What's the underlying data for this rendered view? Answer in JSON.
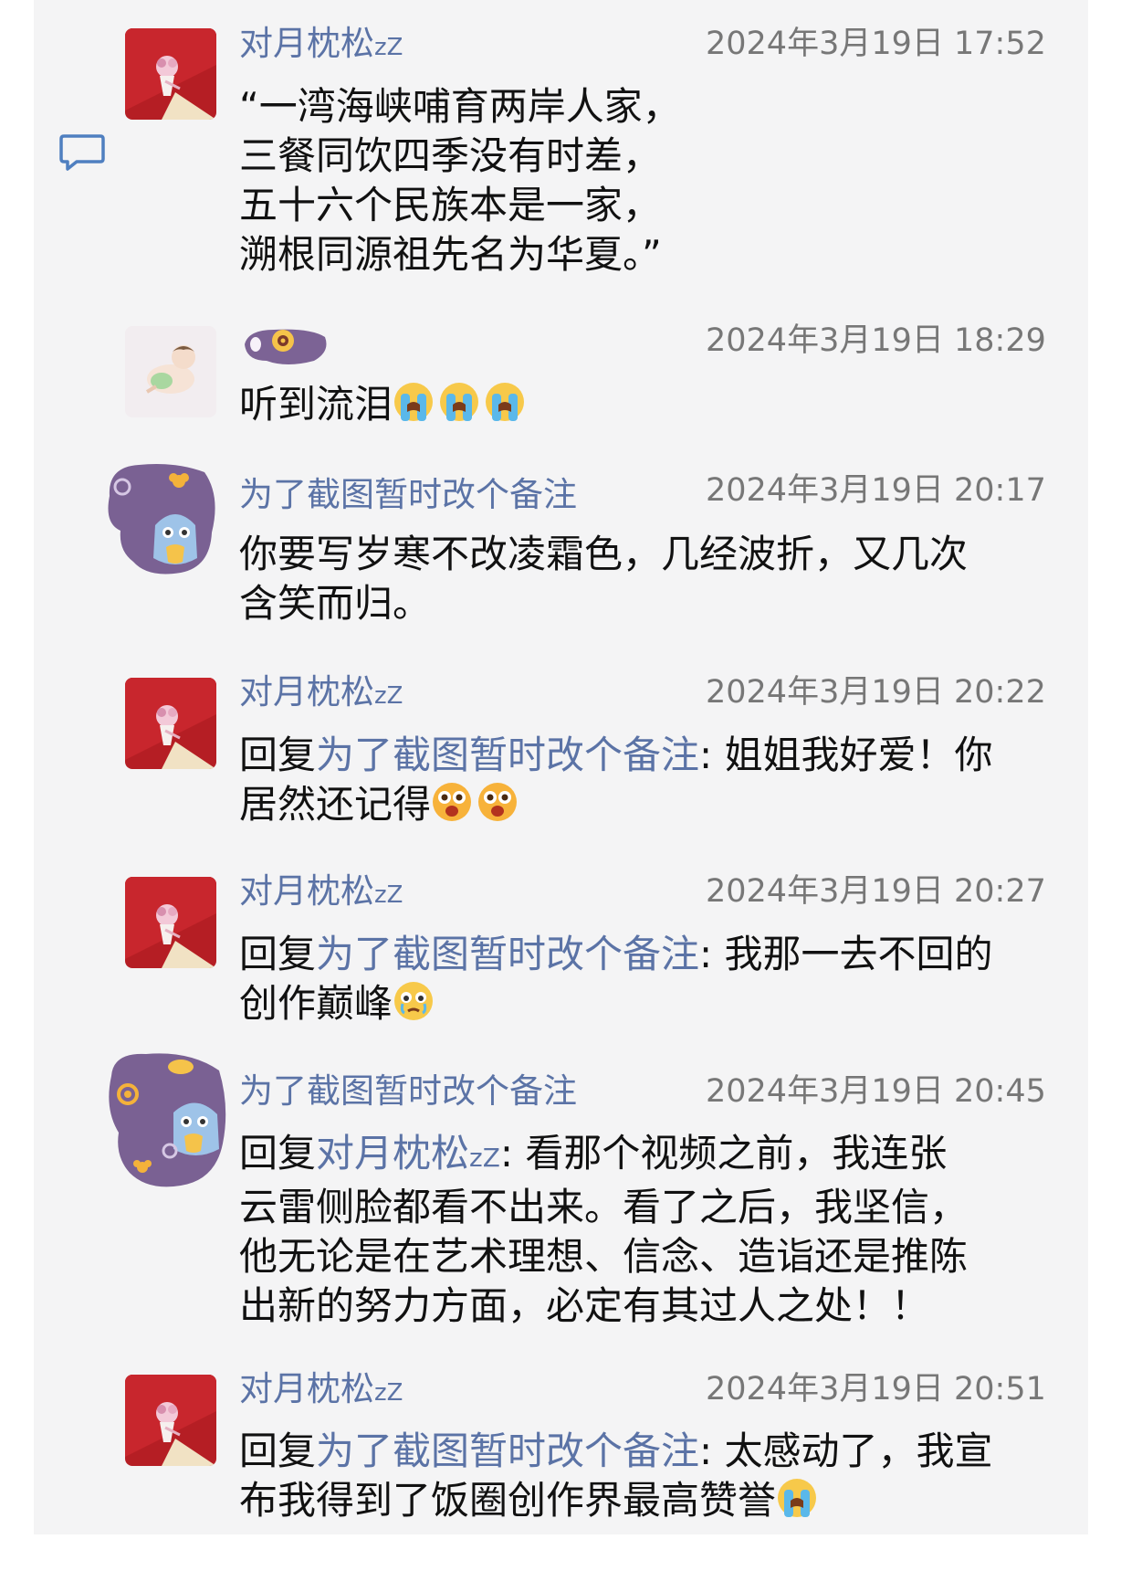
{
  "comments": [
    {
      "username": "对月枕松",
      "username_suffix": "zZ",
      "timestamp": "2024年3月19日 17:52",
      "lines": [
        "“一湾海峡哺育两岸人家，",
        "三餐同饮四季没有时差，",
        "五十六个民族本是一家，",
        "溯根同源祖先名为华夏。”"
      ]
    },
    {
      "username": "",
      "timestamp": "2024年3月19日 18:29",
      "text": "听到流泪",
      "emojis": [
        "crying-face",
        "crying-face",
        "crying-face"
      ]
    },
    {
      "username": "为了截图暂时改个备注",
      "timestamp": "2024年3月19日 20:17",
      "lines": [
        "你要写岁寒不改凌霜色，几经波折，又几次",
        "含笑而归。"
      ]
    },
    {
      "username": "对月枕松",
      "username_suffix": "zZ",
      "timestamp": "2024年3月19日 20:22",
      "reply_prefix": "回复",
      "reply_target": "为了截图暂时改个备注",
      "text_line1": ": 姐姐我好爱！你",
      "text_line2": "居然还记得",
      "emojis": [
        "wow-face",
        "wow-face"
      ]
    },
    {
      "username": "对月枕松",
      "username_suffix": "zZ",
      "timestamp": "2024年3月19日 20:27",
      "reply_prefix": "回复",
      "reply_target": "为了截图暂时改个备注",
      "text_line1": ": 我那一去不回的",
      "text_line2": "创作巅峰",
      "emojis": [
        "teary-face"
      ]
    },
    {
      "username": "为了截图暂时改个备注",
      "timestamp": "2024年3月19日 20:45",
      "reply_prefix": "回复",
      "reply_target": "对月枕松",
      "reply_target_suffix": "zZ",
      "text_line1": ": 看那个视频之前，我连张",
      "lines": [
        "云雷侧脸都看不出来。看了之后，我坚信，",
        "他无论是在艺术理想、信念、造诣还是推陈",
        "出新的努力方面，必定有其过人之处！！"
      ]
    },
    {
      "username": "对月枕松",
      "username_suffix": "zZ",
      "timestamp": "2024年3月19日 20:51",
      "reply_prefix": "回复",
      "reply_target": "为了截图暂时改个备注",
      "text_line1": ": 太感动了，我宣",
      "text_line2": "布我得到了饭圈创作界最高赞誉",
      "emojis": [
        "crying-face"
      ]
    }
  ],
  "colors": {
    "panel": "#f4f4f5",
    "username": "#5b73a6",
    "timestamp": "#777777",
    "text": "#111111"
  },
  "icons": [
    "comment-bubble-icon",
    "avatar-red-bouquet",
    "avatar-baby-sleeping",
    "avatar-purple-owl"
  ]
}
